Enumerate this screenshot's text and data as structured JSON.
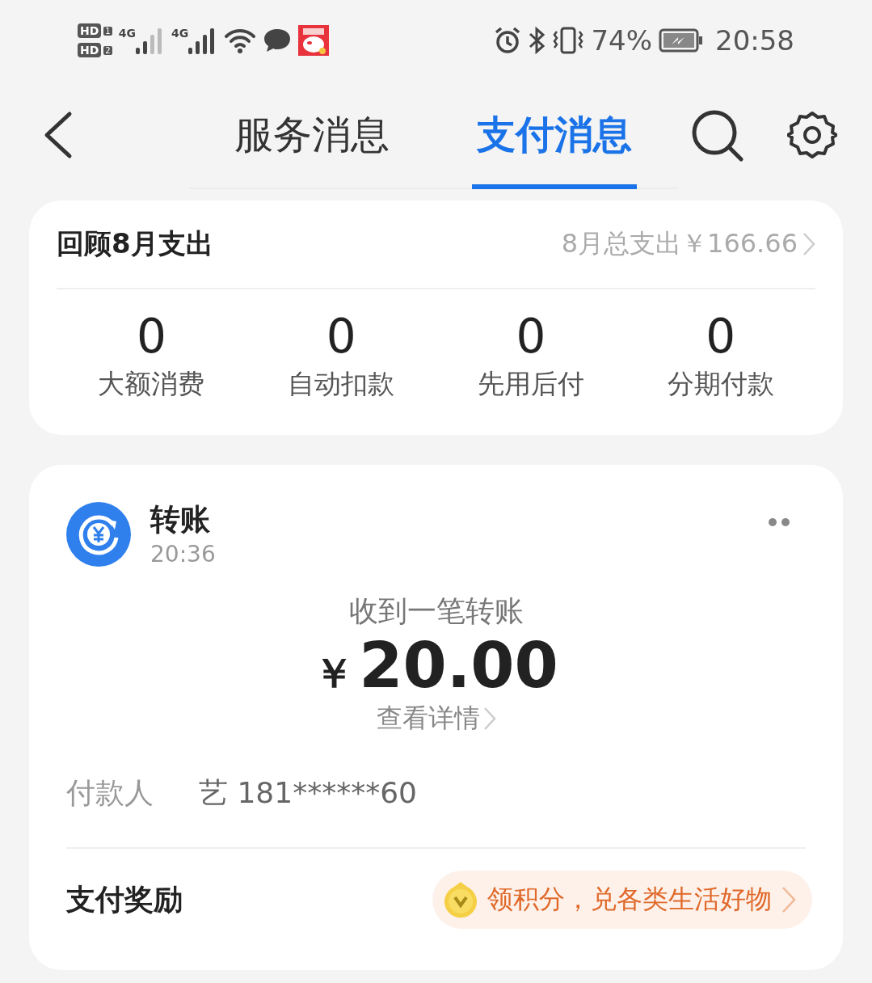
{
  "status_bar": {
    "sims": [
      {
        "badge": "HD",
        "slot": "1",
        "network": "4G"
      },
      {
        "badge": "HD",
        "slot": "2",
        "network": "4G"
      }
    ],
    "battery_percent": "74%",
    "time": "20:58"
  },
  "header": {
    "tabs": [
      {
        "label": "服务消息",
        "selected": false
      },
      {
        "label": "支付消息",
        "selected": true
      }
    ]
  },
  "summary": {
    "title": "回顾8月支出",
    "total": "8月总支出￥166.66",
    "stats": [
      {
        "value": "0",
        "label": "大额消费"
      },
      {
        "value": "0",
        "label": "自动扣款"
      },
      {
        "value": "0",
        "label": "先用后付"
      },
      {
        "value": "0",
        "label": "分期付款"
      }
    ]
  },
  "message": {
    "title": "转账",
    "time": "20:36",
    "headline": "收到一笔转账",
    "currency": "￥",
    "amount": "20.00",
    "detail_link": "查看详情",
    "fields": [
      {
        "label": "付款人",
        "value": "艺 181******60"
      }
    ],
    "reward": {
      "label": "支付奖励",
      "offer": "领积分，兑各类生活好物"
    }
  }
}
